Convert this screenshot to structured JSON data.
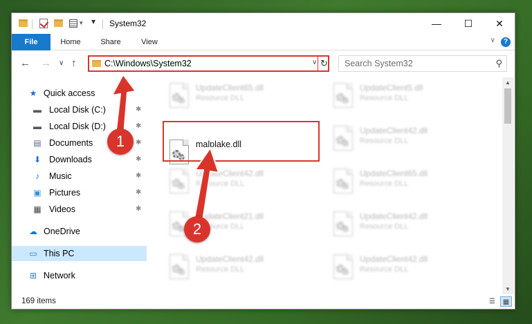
{
  "window": {
    "title": "System32",
    "minimize_glyph": "—",
    "maximize_glyph": "☐",
    "close_glyph": "✕"
  },
  "ribbon": {
    "tabs": [
      "File",
      "Home",
      "Share",
      "View"
    ],
    "help_glyph": "?",
    "expand_glyph": "∨"
  },
  "navigation": {
    "back_glyph": "←",
    "forward_glyph": "→",
    "recent_glyph": "∨",
    "up_glyph": "↑"
  },
  "address_bar": {
    "path": "C:\\Windows\\System32",
    "dropdown_glyph": "∨",
    "refresh_glyph": "↻"
  },
  "search": {
    "placeholder": "Search System32",
    "icon": "search-icon"
  },
  "sidebar": {
    "items": [
      {
        "label": "Quick access",
        "icon": "star-icon",
        "glyph": "★",
        "color": "#1b6fcf",
        "pinned": false,
        "selected": false
      },
      {
        "label": "Local Disk (C:)",
        "icon": "drive-icon",
        "glyph": "▬",
        "color": "#5a5a5a",
        "pinned": true,
        "selected": false
      },
      {
        "label": "Local Disk (D:)",
        "icon": "drive-icon",
        "glyph": "▬",
        "color": "#5a5a5a",
        "pinned": true,
        "selected": false
      },
      {
        "label": "Documents",
        "icon": "documents-icon",
        "glyph": "▤",
        "color": "#5b6a86",
        "pinned": true,
        "selected": false
      },
      {
        "label": "Downloads",
        "icon": "downloads-icon",
        "glyph": "⬇",
        "color": "#1d6fd1",
        "pinned": true,
        "selected": false
      },
      {
        "label": "Music",
        "icon": "music-icon",
        "glyph": "♪",
        "color": "#1d6fd1",
        "pinned": true,
        "selected": false
      },
      {
        "label": "Pictures",
        "icon": "pictures-icon",
        "glyph": "▣",
        "color": "#3a8fd6",
        "pinned": true,
        "selected": false
      },
      {
        "label": "Videos",
        "icon": "videos-icon",
        "glyph": "▦",
        "color": "#444",
        "pinned": true,
        "selected": false
      },
      {
        "label": "OneDrive",
        "icon": "onedrive-icon",
        "glyph": "☁",
        "color": "#1478d4",
        "pinned": false,
        "selected": false
      },
      {
        "label": "This PC",
        "icon": "computer-icon",
        "glyph": "▭",
        "color": "#2d7fd1",
        "pinned": false,
        "selected": true
      },
      {
        "label": "Network",
        "icon": "network-icon",
        "glyph": "⊞",
        "color": "#2d7fd1",
        "pinned": false,
        "selected": false
      }
    ],
    "pin_glyph": "📌"
  },
  "files": [
    {
      "name": "UpdateClient65.dll",
      "type": "Resource DLL",
      "focus": false
    },
    {
      "name": "UpdateClient5.dll",
      "type": "Resource DLL",
      "focus": false
    },
    {
      "name": "malplake.dll",
      "type": "",
      "focus": true
    },
    {
      "name": "UpdateClient42.dll",
      "type": "Resource DLL",
      "focus": false
    },
    {
      "name": "UpdateClient42.dll",
      "type": "Resource DLL",
      "focus": false
    },
    {
      "name": "UpdateClient65.dll",
      "type": "Resource DLL",
      "focus": false
    },
    {
      "name": "UpdateClient21.dll",
      "type": "Resource DLL",
      "focus": false
    },
    {
      "name": "UpdateClient42.dll",
      "type": "Resource DLL",
      "focus": false
    },
    {
      "name": "UpdateClient42.dll",
      "type": "Resource DLL",
      "focus": false
    },
    {
      "name": "UpdateClient42.dll",
      "type": "Resource DLL",
      "focus": false
    }
  ],
  "status": {
    "item_count": "169 items"
  },
  "annotations": {
    "step1": "1",
    "step2": "2",
    "color": "#d9342b"
  }
}
